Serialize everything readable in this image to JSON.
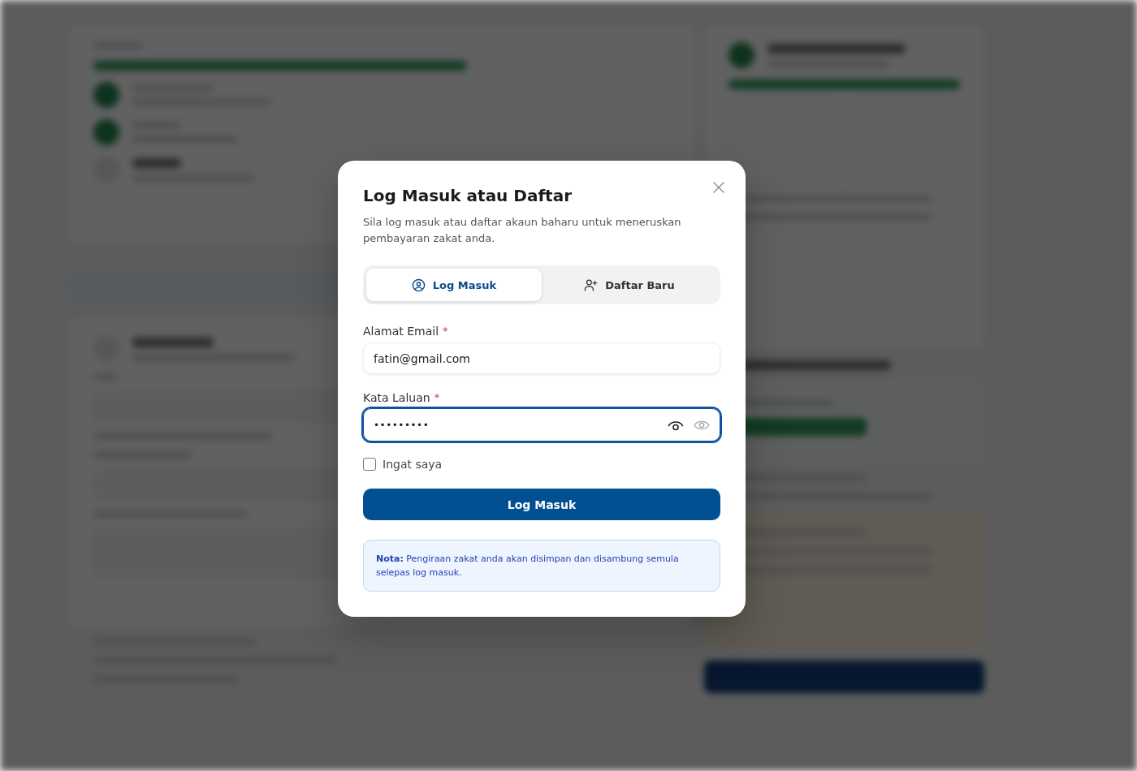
{
  "dialog": {
    "title": "Log Masuk atau Daftar",
    "subtitle": "Sila log masuk atau daftar akaun baharu untuk meneruskan pembayaran zakat anda."
  },
  "tabs": [
    {
      "label": "Log Masuk",
      "kind": "login",
      "selected": true
    },
    {
      "label": "Daftar Baru",
      "kind": "register",
      "selected": false
    }
  ],
  "fields": [
    {
      "label": "Alamat Email",
      "required_mark": "*",
      "value": "fatin@gmail.com",
      "kind": "email",
      "focused": false
    },
    {
      "label": "Kata Laluan",
      "required_mark": "*",
      "value": "•••••••••",
      "kind": "password",
      "focused": true
    }
  ],
  "remember": {
    "label": "Ingat saya",
    "checked": false
  },
  "submit_button": {
    "label": "Log Masuk"
  },
  "note": {
    "text": "**Nota:** Pengiraan zakat anda akan disimpan dan disambung semula selepas log masuk."
  }
}
